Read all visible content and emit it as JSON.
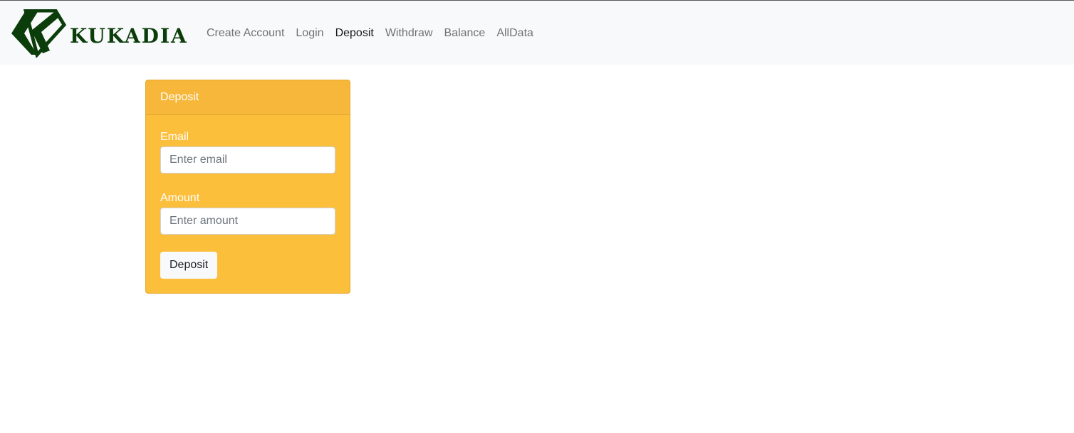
{
  "brand": {
    "name": "KUKADIA",
    "logo_icon": "diamond-k-logo",
    "color": "#0b3d0b"
  },
  "nav": {
    "items": [
      {
        "label": "Create Account",
        "active": false
      },
      {
        "label": "Login",
        "active": false
      },
      {
        "label": "Deposit",
        "active": true
      },
      {
        "label": "Withdraw",
        "active": false
      },
      {
        "label": "Balance",
        "active": false
      },
      {
        "label": "AllData",
        "active": false
      }
    ]
  },
  "card": {
    "header": "Deposit",
    "color": "#fcbf3c",
    "email": {
      "label": "Email",
      "placeholder": "Enter email",
      "value": ""
    },
    "amount": {
      "label": "Amount",
      "placeholder": "Enter amount",
      "value": ""
    },
    "submit_label": "Deposit"
  }
}
